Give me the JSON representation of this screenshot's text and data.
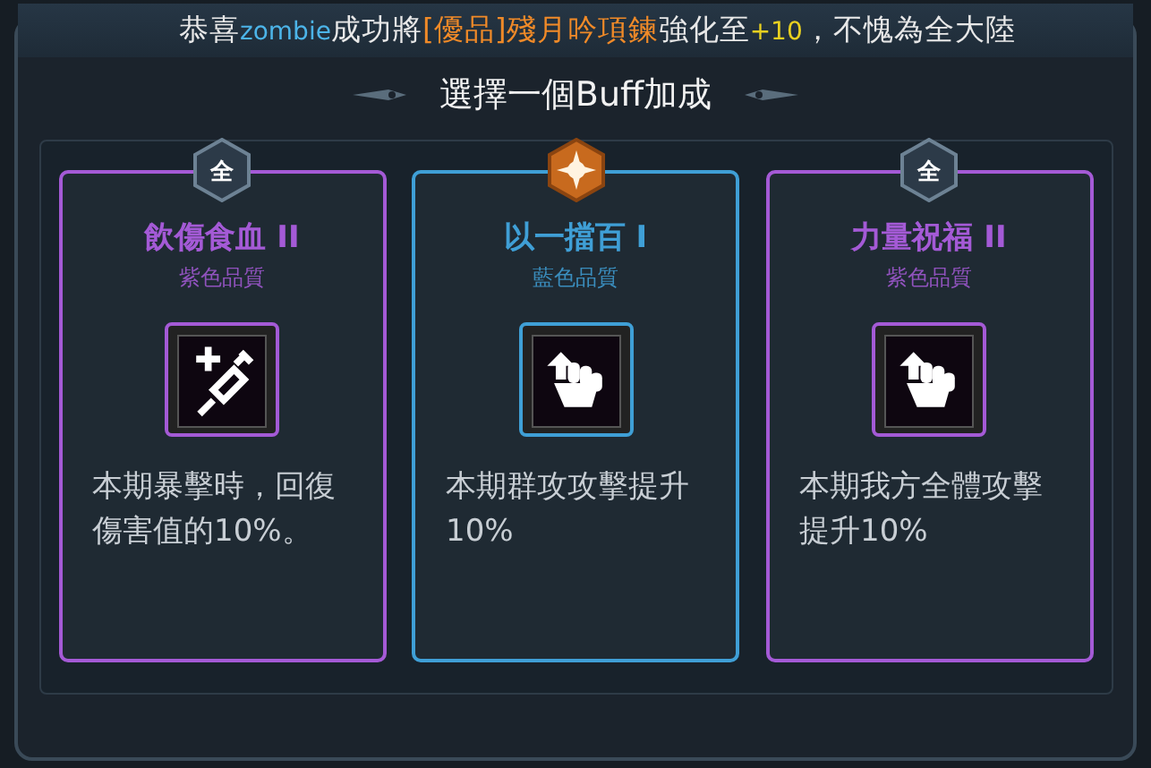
{
  "banner": {
    "segments": [
      {
        "kind": "plain",
        "text": "恭喜"
      },
      {
        "kind": "player",
        "text": "zombie"
      },
      {
        "kind": "plain",
        "text": "成功將"
      },
      {
        "kind": "item",
        "text": "[優品]殘月吟項鍊"
      },
      {
        "kind": "plain",
        "text": "強化至"
      },
      {
        "kind": "bonus",
        "text": "+10"
      },
      {
        "kind": "plain",
        "text": "，不愧為全大陸"
      }
    ]
  },
  "title": "選擇一個Buff加成",
  "cards": [
    {
      "color": "#a45ad6",
      "badge": {
        "kind": "text",
        "text": "全"
      },
      "name": "飲傷食血 II",
      "quality": "紫色品質",
      "kind": "heal",
      "description": "本期暴擊時，回復傷害值的10%。"
    },
    {
      "color": "#3f9fd6",
      "badge": {
        "kind": "emblem"
      },
      "name": "以一擋百 I",
      "quality": "藍色品質",
      "kind": "attack",
      "description": "本期群攻攻擊提升10%"
    },
    {
      "color": "#a45ad6",
      "badge": {
        "kind": "text",
        "text": "全"
      },
      "name": "力量祝福 II",
      "quality": "紫色品質",
      "kind": "attack",
      "description": "本期我方全體攻擊提升10%"
    }
  ]
}
